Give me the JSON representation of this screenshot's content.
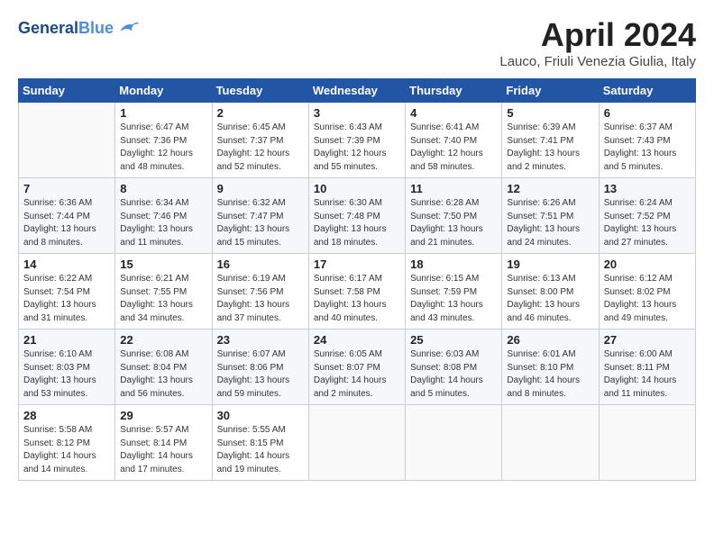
{
  "header": {
    "logo_line1": "General",
    "logo_line2": "Blue",
    "title": "April 2024",
    "subtitle": "Lauco, Friuli Venezia Giulia, Italy"
  },
  "weekdays": [
    "Sunday",
    "Monday",
    "Tuesday",
    "Wednesday",
    "Thursday",
    "Friday",
    "Saturday"
  ],
  "weeks": [
    [
      {
        "day": "",
        "info": ""
      },
      {
        "day": "1",
        "info": "Sunrise: 6:47 AM\nSunset: 7:36 PM\nDaylight: 12 hours\nand 48 minutes."
      },
      {
        "day": "2",
        "info": "Sunrise: 6:45 AM\nSunset: 7:37 PM\nDaylight: 12 hours\nand 52 minutes."
      },
      {
        "day": "3",
        "info": "Sunrise: 6:43 AM\nSunset: 7:39 PM\nDaylight: 12 hours\nand 55 minutes."
      },
      {
        "day": "4",
        "info": "Sunrise: 6:41 AM\nSunset: 7:40 PM\nDaylight: 12 hours\nand 58 minutes."
      },
      {
        "day": "5",
        "info": "Sunrise: 6:39 AM\nSunset: 7:41 PM\nDaylight: 13 hours\nand 2 minutes."
      },
      {
        "day": "6",
        "info": "Sunrise: 6:37 AM\nSunset: 7:43 PM\nDaylight: 13 hours\nand 5 minutes."
      }
    ],
    [
      {
        "day": "7",
        "info": "Sunrise: 6:36 AM\nSunset: 7:44 PM\nDaylight: 13 hours\nand 8 minutes."
      },
      {
        "day": "8",
        "info": "Sunrise: 6:34 AM\nSunset: 7:46 PM\nDaylight: 13 hours\nand 11 minutes."
      },
      {
        "day": "9",
        "info": "Sunrise: 6:32 AM\nSunset: 7:47 PM\nDaylight: 13 hours\nand 15 minutes."
      },
      {
        "day": "10",
        "info": "Sunrise: 6:30 AM\nSunset: 7:48 PM\nDaylight: 13 hours\nand 18 minutes."
      },
      {
        "day": "11",
        "info": "Sunrise: 6:28 AM\nSunset: 7:50 PM\nDaylight: 13 hours\nand 21 minutes."
      },
      {
        "day": "12",
        "info": "Sunrise: 6:26 AM\nSunset: 7:51 PM\nDaylight: 13 hours\nand 24 minutes."
      },
      {
        "day": "13",
        "info": "Sunrise: 6:24 AM\nSunset: 7:52 PM\nDaylight: 13 hours\nand 27 minutes."
      }
    ],
    [
      {
        "day": "14",
        "info": "Sunrise: 6:22 AM\nSunset: 7:54 PM\nDaylight: 13 hours\nand 31 minutes."
      },
      {
        "day": "15",
        "info": "Sunrise: 6:21 AM\nSunset: 7:55 PM\nDaylight: 13 hours\nand 34 minutes."
      },
      {
        "day": "16",
        "info": "Sunrise: 6:19 AM\nSunset: 7:56 PM\nDaylight: 13 hours\nand 37 minutes."
      },
      {
        "day": "17",
        "info": "Sunrise: 6:17 AM\nSunset: 7:58 PM\nDaylight: 13 hours\nand 40 minutes."
      },
      {
        "day": "18",
        "info": "Sunrise: 6:15 AM\nSunset: 7:59 PM\nDaylight: 13 hours\nand 43 minutes."
      },
      {
        "day": "19",
        "info": "Sunrise: 6:13 AM\nSunset: 8:00 PM\nDaylight: 13 hours\nand 46 minutes."
      },
      {
        "day": "20",
        "info": "Sunrise: 6:12 AM\nSunset: 8:02 PM\nDaylight: 13 hours\nand 49 minutes."
      }
    ],
    [
      {
        "day": "21",
        "info": "Sunrise: 6:10 AM\nSunset: 8:03 PM\nDaylight: 13 hours\nand 53 minutes."
      },
      {
        "day": "22",
        "info": "Sunrise: 6:08 AM\nSunset: 8:04 PM\nDaylight: 13 hours\nand 56 minutes."
      },
      {
        "day": "23",
        "info": "Sunrise: 6:07 AM\nSunset: 8:06 PM\nDaylight: 13 hours\nand 59 minutes."
      },
      {
        "day": "24",
        "info": "Sunrise: 6:05 AM\nSunset: 8:07 PM\nDaylight: 14 hours\nand 2 minutes."
      },
      {
        "day": "25",
        "info": "Sunrise: 6:03 AM\nSunset: 8:08 PM\nDaylight: 14 hours\nand 5 minutes."
      },
      {
        "day": "26",
        "info": "Sunrise: 6:01 AM\nSunset: 8:10 PM\nDaylight: 14 hours\nand 8 minutes."
      },
      {
        "day": "27",
        "info": "Sunrise: 6:00 AM\nSunset: 8:11 PM\nDaylight: 14 hours\nand 11 minutes."
      }
    ],
    [
      {
        "day": "28",
        "info": "Sunrise: 5:58 AM\nSunset: 8:12 PM\nDaylight: 14 hours\nand 14 minutes."
      },
      {
        "day": "29",
        "info": "Sunrise: 5:57 AM\nSunset: 8:14 PM\nDaylight: 14 hours\nand 17 minutes."
      },
      {
        "day": "30",
        "info": "Sunrise: 5:55 AM\nSunset: 8:15 PM\nDaylight: 14 hours\nand 19 minutes."
      },
      {
        "day": "",
        "info": ""
      },
      {
        "day": "",
        "info": ""
      },
      {
        "day": "",
        "info": ""
      },
      {
        "day": "",
        "info": ""
      }
    ]
  ]
}
